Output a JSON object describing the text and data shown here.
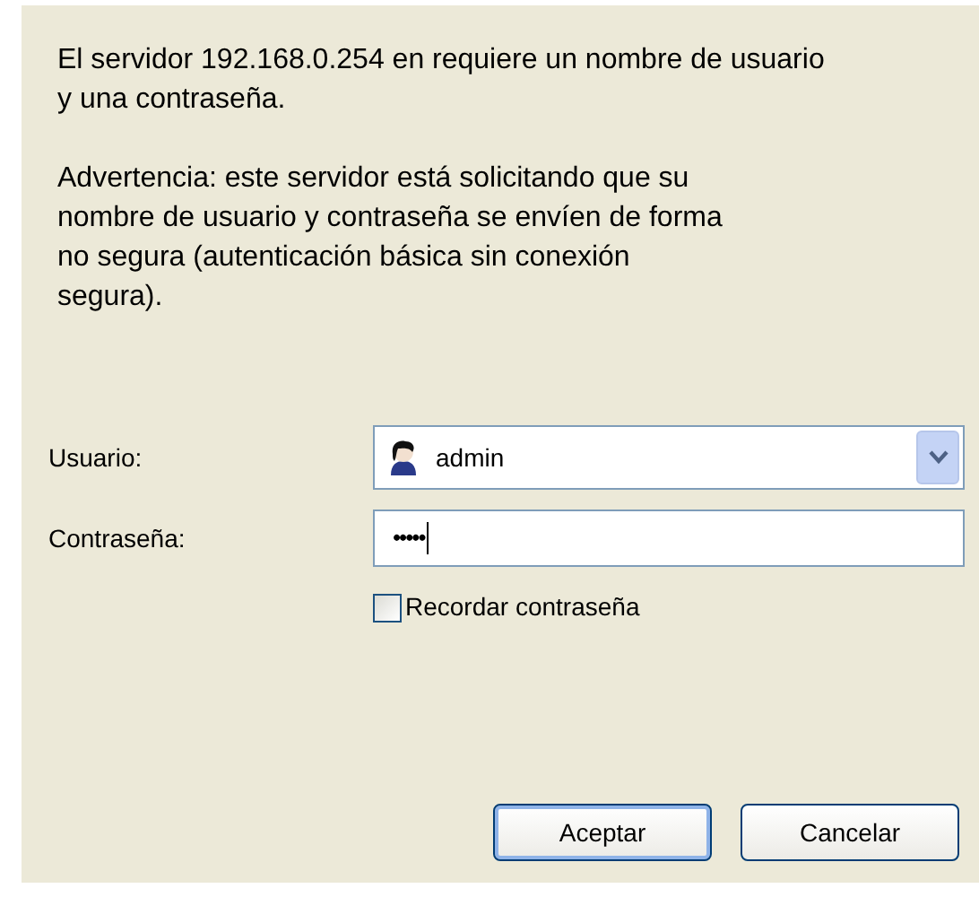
{
  "message": "El servidor 192.168.0.254 en  requiere un nombre de usuario y una contraseña.",
  "warning": "Advertencia: este servidor está solicitando que su nombre de usuario y contraseña se envíen de forma no segura (autenticación básica sin conexión segura).",
  "username": {
    "label": "Usuario:",
    "value": "admin"
  },
  "password": {
    "label": "Contraseña:",
    "value": "•••••",
    "focused": true
  },
  "remember": {
    "label": "Recordar contraseña",
    "checked": false
  },
  "buttons": [
    {
      "label": "Aceptar",
      "default": true
    },
    {
      "label": "Cancelar",
      "default": false
    }
  ]
}
